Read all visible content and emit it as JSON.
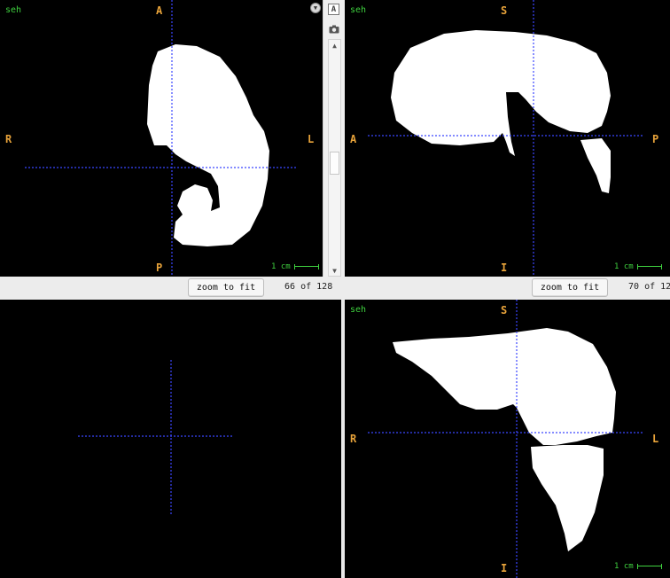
{
  "icons": {
    "collapse": "chevron-down-icon",
    "text_toggle": "text-a-icon",
    "camera": "camera-icon",
    "scroll_up": "triangle-up-icon",
    "scroll_down": "triangle-down-icon"
  },
  "colors": {
    "background": "#000000",
    "mask": "#ffffff",
    "crosshair": "#3b46ff",
    "orientation_label": "#e8a33a",
    "volume_label": "#3fd13f"
  },
  "toolbar": {
    "text_toggle_glyph": "A"
  },
  "views": [
    {
      "id": "axial",
      "volume_name": "seh",
      "labels": {
        "top": "A",
        "bottom": "P",
        "left": "R",
        "right": "L"
      },
      "scale_bar": "1 cm",
      "zoom_button": "zoom to fit",
      "slice": {
        "current": "66",
        "of_text": "of",
        "total": "128"
      }
    },
    {
      "id": "sagittal",
      "volume_name": "seh",
      "labels": {
        "top": "S",
        "bottom": "I",
        "left": "A",
        "right": "P"
      },
      "scale_bar": "1 cm",
      "zoom_button": "zoom to fit",
      "slice": {
        "current": "70",
        "of_text": "of",
        "total": "12"
      }
    },
    {
      "id": "3d",
      "volume_name": "",
      "labels": {
        "top": "",
        "bottom": "",
        "left": "",
        "right": ""
      }
    },
    {
      "id": "coronal",
      "volume_name": "seh",
      "labels": {
        "top": "S",
        "bottom": "I",
        "left": "R",
        "right": "L"
      },
      "scale_bar": "1 cm"
    }
  ]
}
